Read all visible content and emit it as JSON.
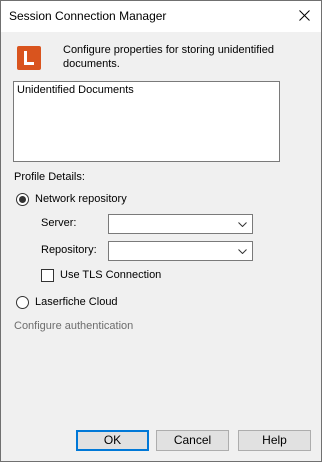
{
  "window": {
    "title": "Session Connection Manager"
  },
  "header": {
    "logo_letter": "L",
    "description": "Configure properties for storing unidentified documents."
  },
  "documents_list": {
    "items": [
      "Unidentified Documents"
    ]
  },
  "profile": {
    "section_label": "Profile Details:",
    "options": [
      {
        "label": "Network repository",
        "selected": true
      },
      {
        "label": "Laserfiche Cloud",
        "selected": false
      }
    ],
    "server": {
      "label": "Server:",
      "value": ""
    },
    "repository": {
      "label": "Repository:",
      "value": ""
    },
    "tls": {
      "label": "Use TLS Connection",
      "checked": false
    },
    "configure_auth": "Configure authentication"
  },
  "buttons": {
    "ok": "OK",
    "cancel": "Cancel",
    "help": "Help"
  },
  "colors": {
    "logo_bg": "#d9541e",
    "default_button_border": "#0078d7",
    "window_bg": "#f0f0f0",
    "disabled_text": "#6d6d6d"
  },
  "icons": {
    "close": "close-icon",
    "dropdown": "chevron-down-icon",
    "logo": "laserfiche-logo-icon"
  }
}
